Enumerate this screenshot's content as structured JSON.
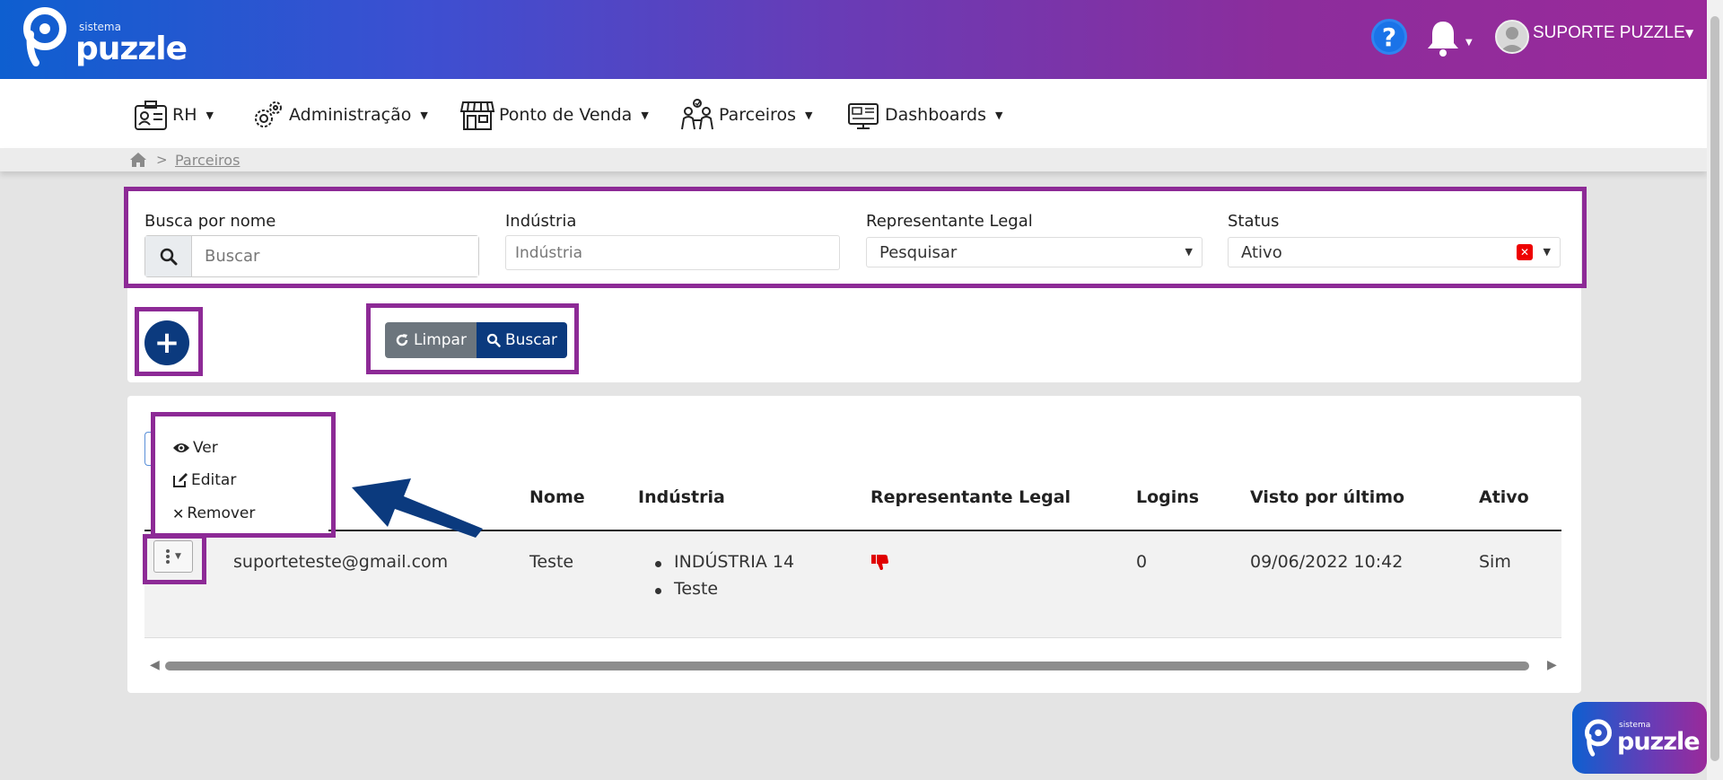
{
  "brand": {
    "small": "sistema",
    "name": "puzzle"
  },
  "header": {
    "help_symbol": "?",
    "user_name": "SUPORTE PUZZLE"
  },
  "nav": {
    "items": [
      {
        "label": "RH",
        "icon": "id-card-icon"
      },
      {
        "label": "Administração",
        "icon": "gears-icon"
      },
      {
        "label": "Ponto de Venda",
        "icon": "store-icon"
      },
      {
        "label": "Parceiros",
        "icon": "partners-icon"
      },
      {
        "label": "Dashboards",
        "icon": "dashboard-monitor-icon"
      }
    ]
  },
  "breadcrumb": {
    "separator": ">",
    "current": "Parceiros"
  },
  "filters": {
    "name_label": "Busca por nome",
    "name_placeholder": "Buscar",
    "industry_label": "Indústria",
    "industry_placeholder": "Indústria",
    "legal_rep_label": "Representante Legal",
    "legal_rep_value": "Pesquisar",
    "status_label": "Status",
    "status_value": "Ativo",
    "clear_label": "Limpar",
    "search_label": "Buscar"
  },
  "add_symbol": "+",
  "row_menu": {
    "items": [
      "Ver",
      "Editar",
      "Remover"
    ]
  },
  "table": {
    "headers": [
      "Nome",
      "Indústria",
      "Representante Legal",
      "Logins",
      "Visto por último",
      "Ativo"
    ],
    "rows": [
      {
        "email": "suporteteste@gmail.com",
        "name": "Teste",
        "industries": [
          "INDÚSTRIA 14",
          "Teste"
        ],
        "legal_rep_icon": "thumbs-down-icon",
        "logins": "0",
        "last_seen": "09/06/2022 10:42",
        "active": "Sim"
      }
    ]
  },
  "colors": {
    "highlight": "#8d2a96",
    "primary": "#0b3a7e",
    "secondary": "#6c757d",
    "thumbs_down": "#e00000"
  }
}
